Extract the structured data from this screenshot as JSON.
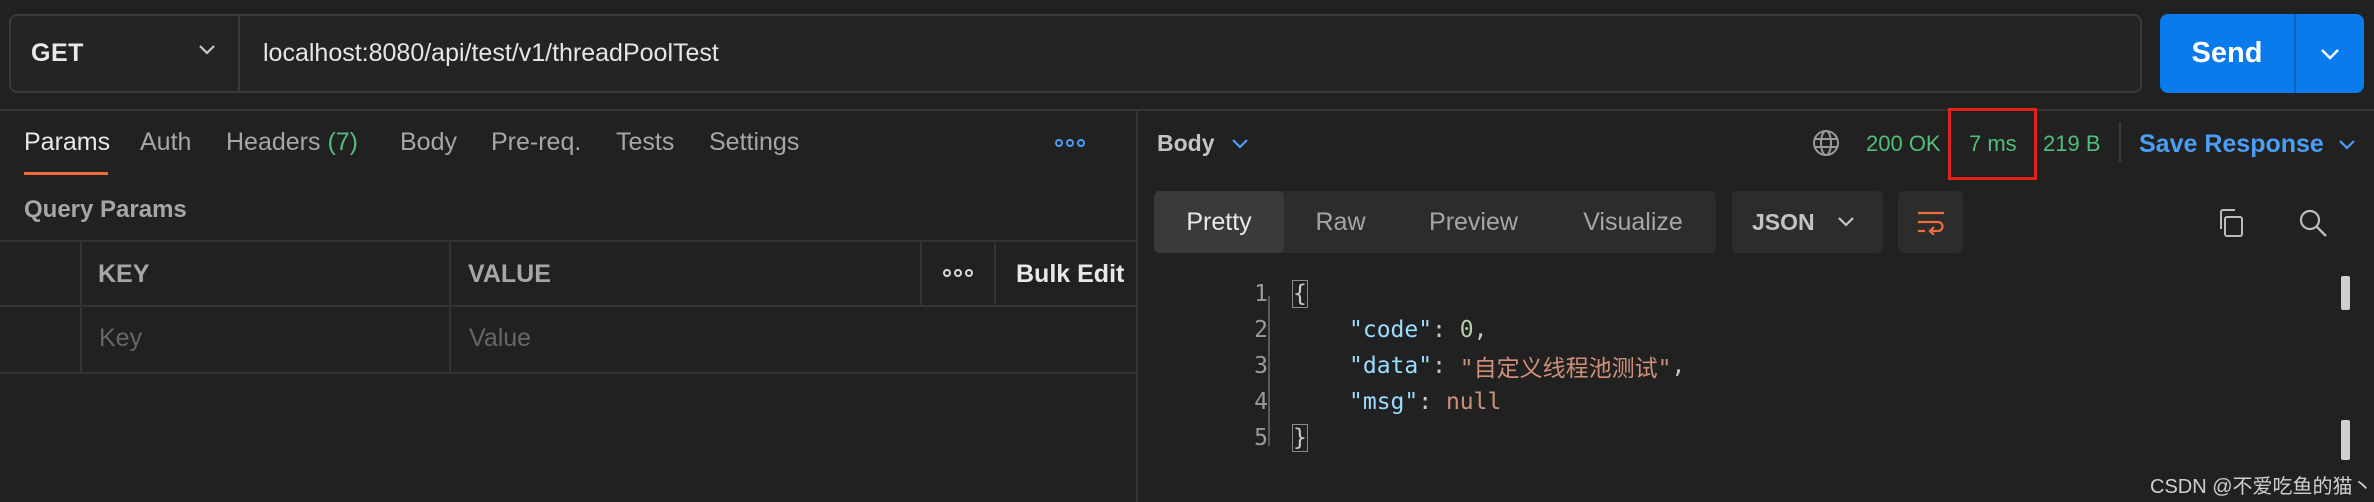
{
  "request": {
    "method": "GET",
    "url": "localhost:8080/api/test/v1/threadPoolTest",
    "send_label": "Send"
  },
  "request_tabs": [
    {
      "label": "Params",
      "active": true
    },
    {
      "label": "Auth"
    },
    {
      "label": "Headers",
      "count": "(7)"
    },
    {
      "label": "Body"
    },
    {
      "label": "Pre-req."
    },
    {
      "label": "Tests"
    },
    {
      "label": "Settings"
    }
  ],
  "query_params": {
    "title": "Query Params",
    "columns": {
      "key": "KEY",
      "value": "VALUE",
      "bulk_edit": "Bulk Edit"
    },
    "placeholder_row": {
      "key": "Key",
      "value": "Value"
    }
  },
  "response": {
    "body_dropdown": "Body",
    "status": "200 OK",
    "time": "7 ms",
    "size": "219 B",
    "save_label": "Save Response",
    "view_tabs": [
      {
        "label": "Pretty",
        "active": true
      },
      {
        "label": "Raw"
      },
      {
        "label": "Preview"
      },
      {
        "label": "Visualize"
      }
    ],
    "format": "JSON",
    "code_lines": [
      {
        "n": "1",
        "open": "{"
      },
      {
        "n": "2",
        "key": "\"code\"",
        "value": "0",
        "type": "num",
        "trail": ","
      },
      {
        "n": "3",
        "key": "\"data\"",
        "value": "\"自定义线程池测试\"",
        "type": "str",
        "trail": ","
      },
      {
        "n": "4",
        "key": "\"msg\"",
        "value": "null",
        "type": "nul",
        "trail": ""
      },
      {
        "n": "5",
        "close": "}"
      }
    ]
  },
  "colors": {
    "accent": "#097bed",
    "status_ok": "#4fbf7a",
    "active_tab_underline": "#f26b3a",
    "highlight_box": "#e0231c"
  },
  "watermark": "CSDN @不爱吃鱼的猫丶"
}
